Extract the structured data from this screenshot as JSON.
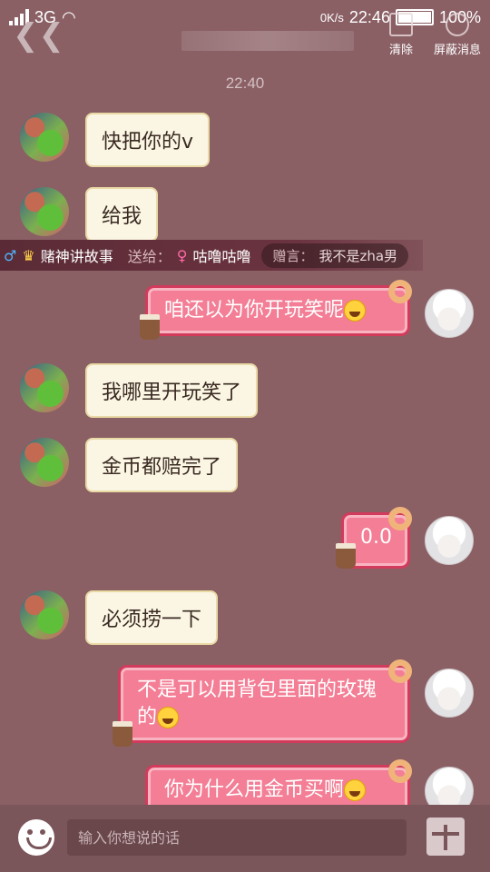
{
  "status_bar": {
    "network": "3G",
    "speed": "0K/s",
    "time": "22:46",
    "battery": "100%"
  },
  "header": {
    "clear_label": "清除",
    "block_label": "屏蔽消息"
  },
  "timestamp": "22:40",
  "messages": [
    {
      "side": "left",
      "text": "快把你的v"
    },
    {
      "side": "left",
      "text": "给我"
    },
    {
      "side": "right",
      "text": "咱还以为你开玩笑呢"
    },
    {
      "side": "left",
      "text": "我哪里开玩笑了"
    },
    {
      "side": "left",
      "text": "金币都赔完了"
    },
    {
      "side": "right",
      "text": "0.0"
    },
    {
      "side": "left",
      "text": "必须捞一下"
    },
    {
      "side": "right",
      "text": "不是可以用背包里面的玫瑰的"
    },
    {
      "side": "right",
      "text": "你为什么用金币买啊"
    }
  ],
  "gift_banner": {
    "sender": "赌神讲故事",
    "sender_level": "6",
    "send_to_label": "送给：",
    "receiver": "咕噜咕噜",
    "words_label": "赠言：",
    "words": "我不是zha男"
  },
  "input": {
    "placeholder": "输入你想说的话"
  },
  "colors": {
    "background": "#8a6065",
    "left_bubble": "#fbf6e4",
    "right_bubble": "#f37e95",
    "right_bubble_border": "#d23b5c"
  }
}
